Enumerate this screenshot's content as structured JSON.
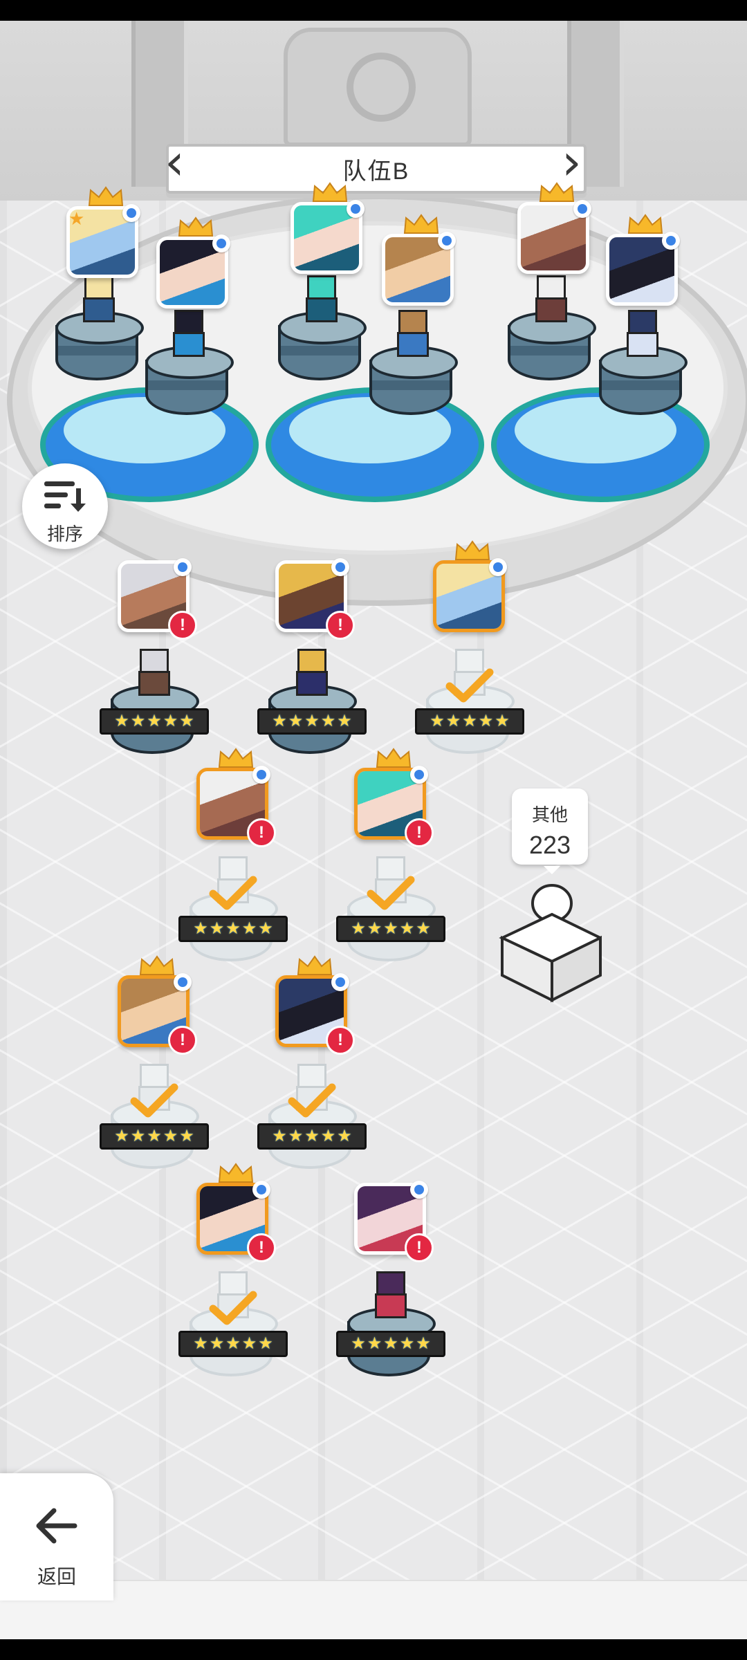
{
  "team": {
    "title": "队伍B",
    "prev_icon": "chevron-left-icon",
    "next_icon": "chevron-right-icon"
  },
  "sort": {
    "label": "排序",
    "icon": "sort-icon"
  },
  "others": {
    "label": "其他",
    "count": "223"
  },
  "back": {
    "label": "返回",
    "icon": "arrow-left-icon"
  },
  "colors": {
    "selected_border": "#f19a1f",
    "alert": "#e32742",
    "pool": "#2f89e3",
    "pool_rim": "#23a79e",
    "crown": "#f7b82a"
  },
  "team_slots": [
    {
      "portrait": "blonde-knight",
      "crowned": true,
      "leader_star": true
    },
    {
      "portrait": "black-hair-girl",
      "crowned": true
    },
    {
      "portrait": "teal-hair-girl",
      "crowned": true
    },
    {
      "portrait": "brown-hair-boy",
      "crowned": true
    },
    {
      "portrait": "white-hair-dark-skin",
      "crowned": true
    },
    {
      "portrait": "armored-mech",
      "crowned": true
    }
  ],
  "roster": [
    {
      "portrait": "silver-hair-girl",
      "crowned": false,
      "selected": false,
      "in_team": false,
      "alert": true,
      "stars": 5
    },
    {
      "portrait": "blonde-dark-skin",
      "crowned": false,
      "selected": false,
      "in_team": false,
      "alert": true,
      "stars": 5
    },
    {
      "portrait": "blonde-knight",
      "crowned": true,
      "selected": true,
      "in_team": true,
      "alert": false,
      "stars": 5
    },
    {
      "portrait": "white-hair-dark-skin",
      "crowned": true,
      "selected": true,
      "in_team": true,
      "alert": true,
      "stars": 5
    },
    {
      "portrait": "teal-hair-girl",
      "crowned": true,
      "selected": true,
      "in_team": true,
      "alert": true,
      "stars": 5
    },
    {
      "portrait": "brown-hair-boy",
      "crowned": true,
      "selected": true,
      "in_team": true,
      "alert": true,
      "stars": 5
    },
    {
      "portrait": "armored-mech",
      "crowned": true,
      "selected": true,
      "in_team": true,
      "alert": true,
      "stars": 5
    },
    {
      "portrait": "black-hair-girl",
      "crowned": true,
      "selected": true,
      "in_team": true,
      "alert": true,
      "stars": 5
    },
    {
      "portrait": "purple-hair-girl",
      "crowned": false,
      "selected": false,
      "in_team": false,
      "alert": true,
      "stars": 5
    }
  ]
}
